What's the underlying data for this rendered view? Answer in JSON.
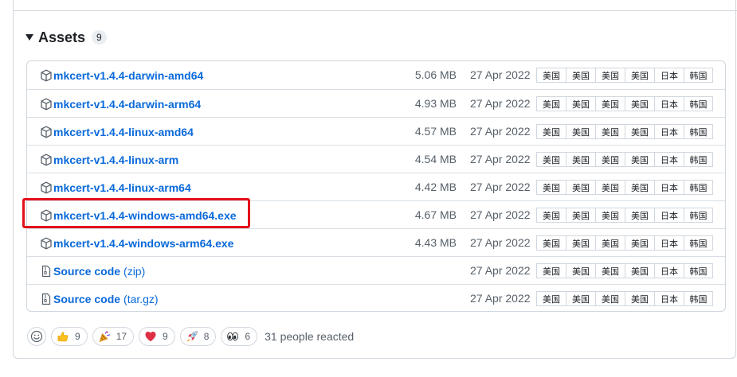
{
  "assets": {
    "title": "Assets",
    "count": "9",
    "tag_labels": [
      "美国",
      "美国",
      "美国",
      "美国",
      "日本",
      "韩国"
    ],
    "items": [
      {
        "name": "mkcert-v1.4.4-darwin-amd64",
        "size": "5.06 MB",
        "date": "27 Apr 2022",
        "icon": "package-icon"
      },
      {
        "name": "mkcert-v1.4.4-darwin-arm64",
        "size": "4.93 MB",
        "date": "27 Apr 2022",
        "icon": "package-icon"
      },
      {
        "name": "mkcert-v1.4.4-linux-amd64",
        "size": "4.57 MB",
        "date": "27 Apr 2022",
        "icon": "package-icon"
      },
      {
        "name": "mkcert-v1.4.4-linux-arm",
        "size": "4.54 MB",
        "date": "27 Apr 2022",
        "icon": "package-icon"
      },
      {
        "name": "mkcert-v1.4.4-linux-arm64",
        "size": "4.42 MB",
        "date": "27 Apr 2022",
        "icon": "package-icon"
      },
      {
        "name": "mkcert-v1.4.4-windows-amd64.exe",
        "size": "4.67 MB",
        "date": "27 Apr 2022",
        "icon": "package-icon",
        "highlighted": true
      },
      {
        "name": "mkcert-v1.4.4-windows-arm64.exe",
        "size": "4.43 MB",
        "date": "27 Apr 2022",
        "icon": "package-icon"
      },
      {
        "name": "Source code",
        "suffix": "(zip)",
        "size": "",
        "date": "27 Apr 2022",
        "icon": "file-zip-icon"
      },
      {
        "name": "Source code",
        "suffix": "(tar.gz)",
        "size": "",
        "date": "27 Apr 2022",
        "icon": "file-zip-icon"
      }
    ]
  },
  "reactions": {
    "items": [
      {
        "emoji": "thumbs-up-icon",
        "count": "9"
      },
      {
        "emoji": "party-popper-icon",
        "count": "17"
      },
      {
        "emoji": "heart-icon",
        "count": "9"
      },
      {
        "emoji": "rocket-icon",
        "count": "8"
      },
      {
        "emoji": "eyes-icon",
        "count": "6"
      }
    ],
    "summary": "31 people reacted"
  },
  "colors": {
    "link": "#0969da",
    "highlight": "#e3111a",
    "border": "#d0d7de",
    "muted": "#57606a"
  }
}
